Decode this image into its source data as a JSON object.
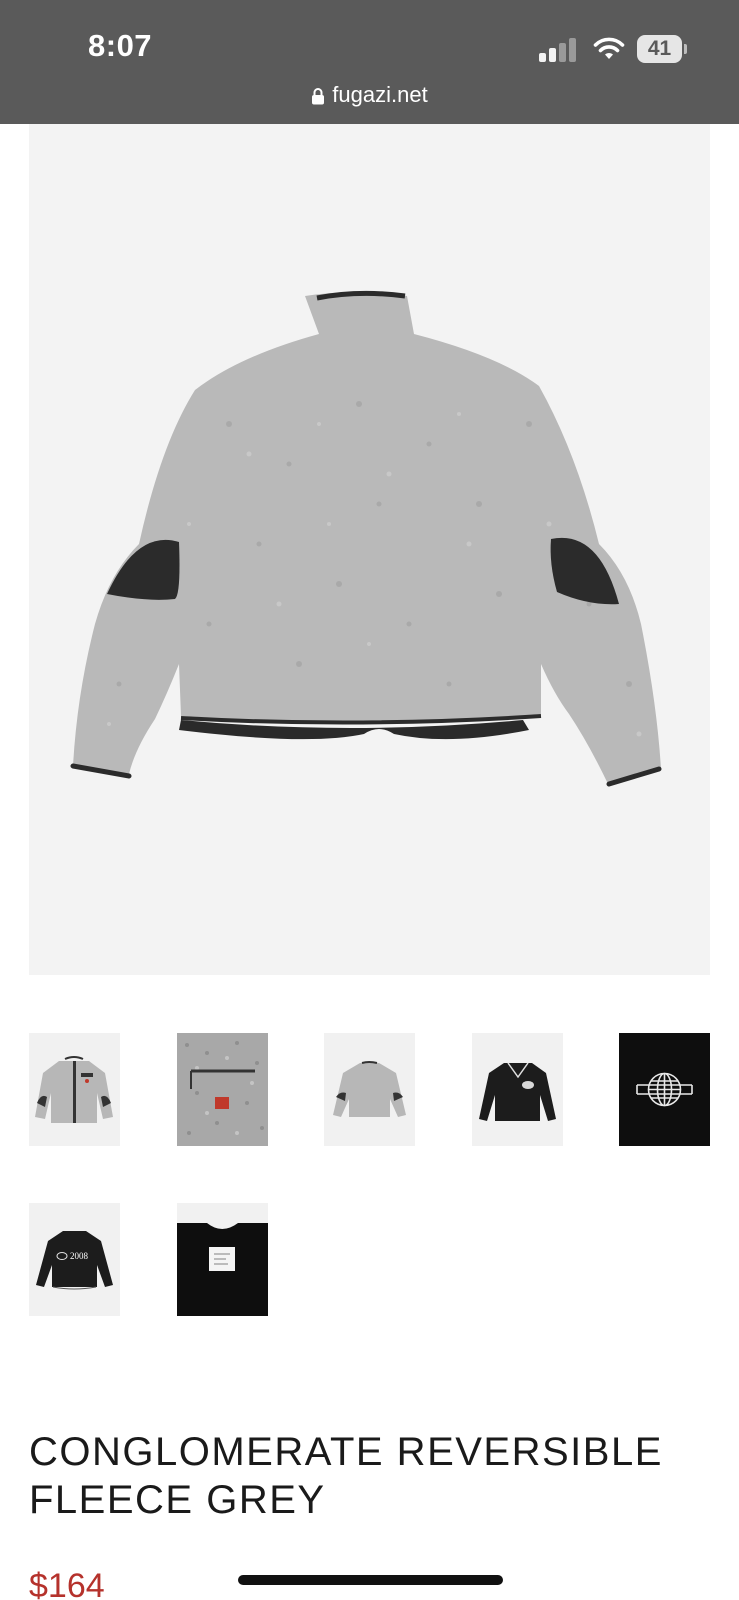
{
  "status_bar": {
    "time": "8:07",
    "battery": "41"
  },
  "browser": {
    "url": "fugazi.net"
  },
  "product": {
    "title": "CONGLOMERATE REVERSIBLE FLEECE GREY",
    "price": "$164",
    "colors": {
      "image_bg": "#f3f3f3",
      "fleece": "#b9b9b9",
      "patch": "#2b2b2b",
      "price": "#b5322c"
    }
  },
  "thumbnails": [
    {
      "name": "thumb-front-fleece"
    },
    {
      "name": "thumb-pocket-detail"
    },
    {
      "name": "thumb-back-fleece"
    },
    {
      "name": "thumb-black-jacket-front"
    },
    {
      "name": "thumb-globe-logo"
    },
    {
      "name": "thumb-black-jacket-back"
    },
    {
      "name": "thumb-label-detail"
    }
  ],
  "thumb_texts": {
    "year_print": "2008"
  }
}
